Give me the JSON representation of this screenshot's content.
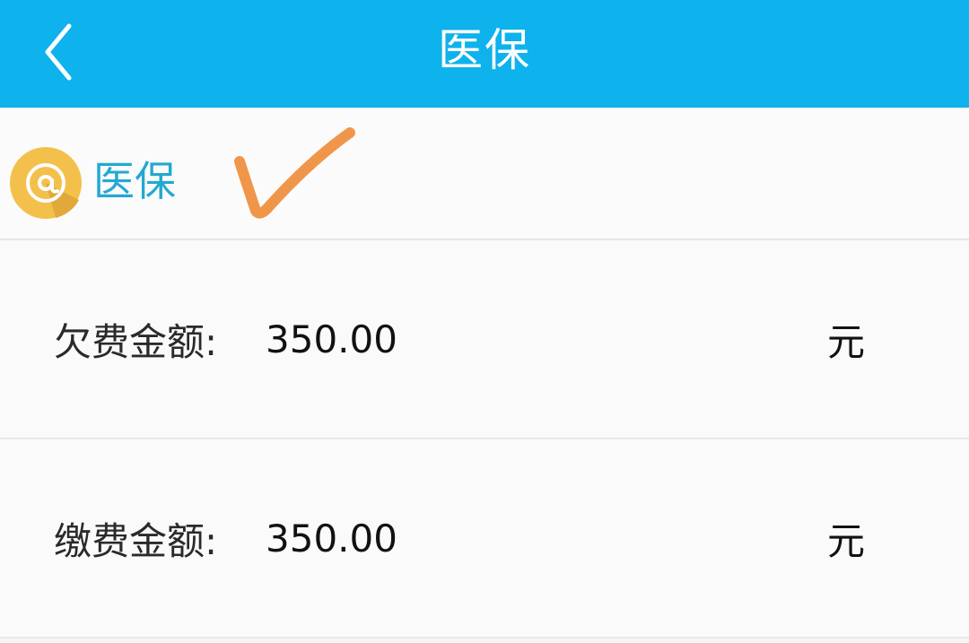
{
  "header": {
    "title": "医保",
    "back_icon": "chevron-left-icon",
    "background_color": "#0eb2ec"
  },
  "section": {
    "title": "医保",
    "badge_icon": "at-sign-icon",
    "badge_color": "#f4c04c",
    "annotation": "orange-checkmark-icon",
    "title_color": "#23a8d2"
  },
  "rows": [
    {
      "label": "欠费金额:",
      "value": "350.00",
      "unit": "元"
    },
    {
      "label": "缴费金额:",
      "value": "350.00",
      "unit": "元"
    }
  ]
}
